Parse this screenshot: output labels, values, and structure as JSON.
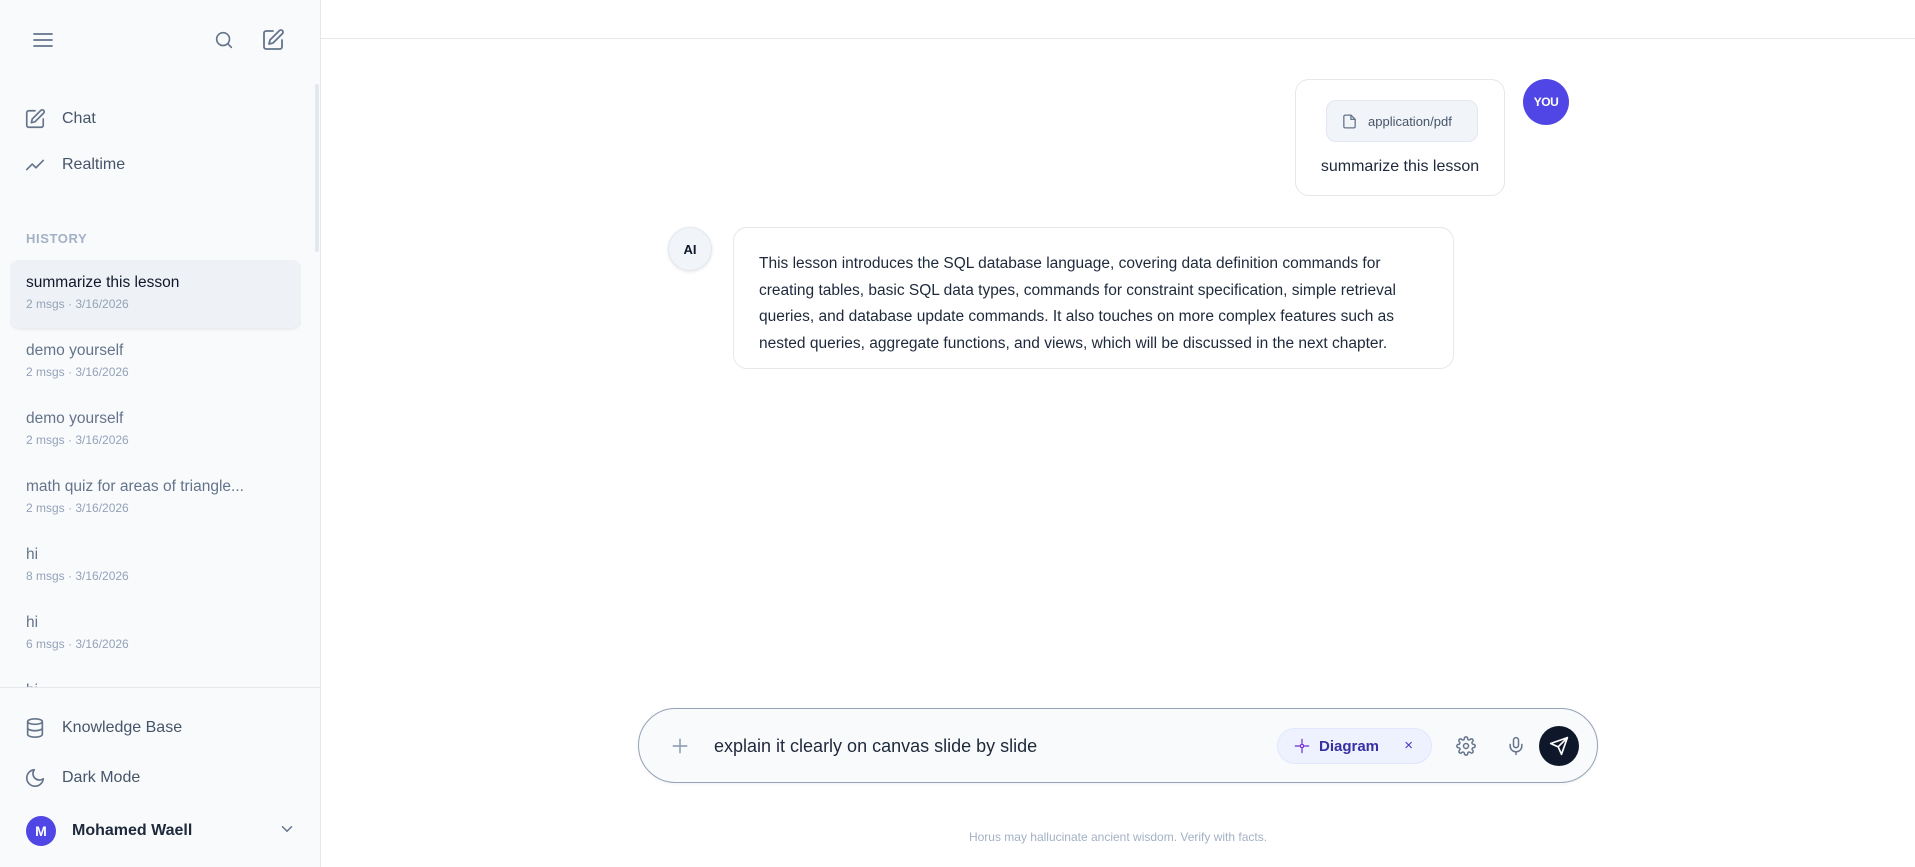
{
  "sidebar": {
    "nav": [
      {
        "label": "Chat",
        "icon": "edit-icon"
      },
      {
        "label": "Realtime",
        "icon": "trend-icon"
      }
    ],
    "history_label": "HISTORY",
    "history": [
      {
        "title": "summarize this lesson",
        "meta": "2 msgs · 3/16/2026",
        "active": true
      },
      {
        "title": "demo yourself",
        "meta": "2 msgs · 3/16/2026"
      },
      {
        "title": "demo yourself",
        "meta": "2 msgs · 3/16/2026"
      },
      {
        "title": "math quiz for areas of triangle...",
        "meta": "2 msgs · 3/16/2026"
      },
      {
        "title": "hi",
        "meta": "8 msgs · 3/16/2026"
      },
      {
        "title": "hi",
        "meta": "6 msgs · 3/16/2026"
      },
      {
        "title": "hi",
        "meta": ""
      }
    ],
    "bottom": [
      {
        "label": "Knowledge Base",
        "icon": "database-icon"
      },
      {
        "label": "Dark Mode",
        "icon": "moon-icon"
      }
    ],
    "user": {
      "initial": "M",
      "name": "Mohamed Waell"
    }
  },
  "chat": {
    "user_message": {
      "attachment": "application/pdf",
      "text": "summarize this lesson",
      "badge": "YOU"
    },
    "ai_message": {
      "badge": "AI",
      "text": "This lesson introduces the SQL database language, covering data definition commands for creating tables, basic SQL data types, commands for constraint specification, simple retrieval queries, and database update commands. It also touches on more complex features such as nested queries, aggregate functions, and views, which will be discussed in the next chapter."
    }
  },
  "composer": {
    "value": "explain it clearly on canvas slide by slide",
    "mode_chip": "Diagram",
    "close": "×"
  },
  "disclaimer": "Horus may hallucinate ancient wisdom. Verify with facts.",
  "colors": {
    "accent": "#4f46e5",
    "send": "#0f172a",
    "chip_bg": "#eef2ff"
  }
}
